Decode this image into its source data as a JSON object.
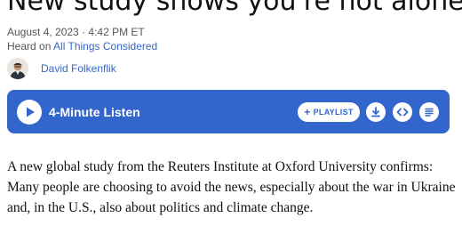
{
  "story": {
    "headline": "New study shows you're not alone",
    "date": "August 4, 2023 · 4:42 PM ET",
    "heard_on_prefix": "Heard on ",
    "heard_on_program": "All Things Considered",
    "author": "David Folkenflik"
  },
  "player": {
    "listen_label": "4-Minute Listen",
    "playlist_label": "PLAYLIST",
    "icons": [
      "play-icon",
      "plus-icon",
      "download-icon",
      "embed-icon",
      "transcript-icon"
    ],
    "accent_color": "#3366cc"
  },
  "body": {
    "paragraph": "A new global study from the Reuters Institute at Oxford University confirms: Many people are choosing to avoid the news, especially about the war in Ukraine and, in the U.S., also about politics and climate change."
  }
}
